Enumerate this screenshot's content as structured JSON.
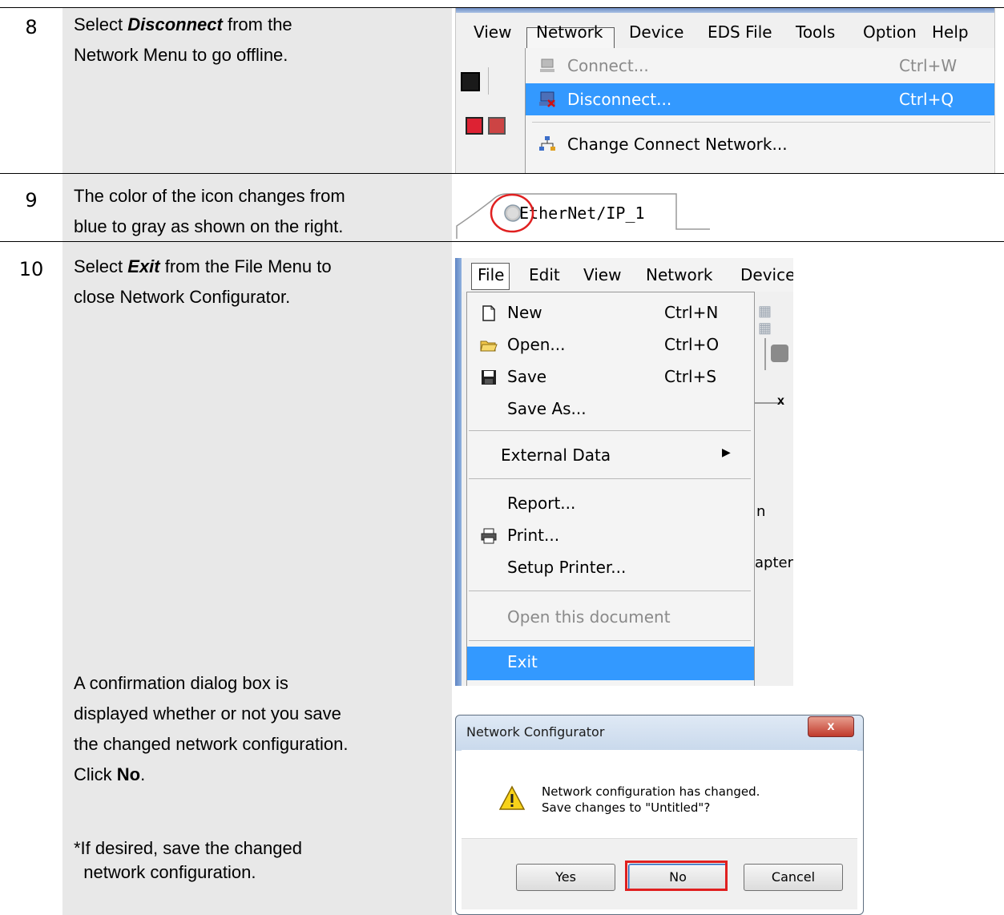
{
  "steps": [
    {
      "number": "8",
      "text_parts": [
        "Select ",
        "Disconnect",
        " from the",
        "Network Menu to go offline."
      ]
    },
    {
      "number": "9",
      "lines": [
        "The color of the icon changes from",
        "blue to gray as shown on the right."
      ]
    },
    {
      "number": "10",
      "text_parts": [
        "Select ",
        "Exit",
        " from the File Menu to",
        "close Network Configurator."
      ],
      "confirm_lines": [
        "A confirmation dialog box is",
        "displayed whether or not you save",
        "the changed network configuration."
      ],
      "click_prefix": "Click ",
      "click_target": "No",
      "click_suffix": ".",
      "note_lines": [
        "*If desired, save the changed",
        "network configuration."
      ]
    }
  ],
  "network_menu_shot": {
    "menubar": [
      "View",
      "Network",
      "Device",
      "EDS File",
      "Tools",
      "Option",
      "Help"
    ],
    "items": [
      {
        "label": "Connect...",
        "shortcut": "Ctrl+W",
        "state": "disabled"
      },
      {
        "label": "Disconnect...",
        "shortcut": "Ctrl+Q",
        "state": "highlighted"
      },
      {
        "label": "Change Connect Network...",
        "shortcut": "",
        "state": "normal"
      }
    ]
  },
  "tab_shot": {
    "tab_label": "EtherNet/IP_1"
  },
  "file_menu_shot": {
    "menubar": [
      "File",
      "Edit",
      "View",
      "Network",
      "Device"
    ],
    "items": [
      {
        "label": "New",
        "shortcut": "Ctrl+N"
      },
      {
        "label": "Open...",
        "shortcut": "Ctrl+O"
      },
      {
        "label": "Save",
        "shortcut": "Ctrl+S"
      },
      {
        "label": "Save As...",
        "shortcut": ""
      },
      {
        "label": "External Data",
        "shortcut": ""
      },
      {
        "label": "Report...",
        "shortcut": ""
      },
      {
        "label": "Print...",
        "shortcut": ""
      },
      {
        "label": "Setup Printer...",
        "shortcut": ""
      },
      {
        "label": "Open this document",
        "shortcut": "",
        "state": "disabled"
      },
      {
        "label": "Exit",
        "shortcut": "",
        "state": "highlighted"
      }
    ],
    "background_text": [
      "n",
      "apter"
    ]
  },
  "dialog": {
    "title": "Network Configurator",
    "close_glyph": "x",
    "message_line1": "Network configuration has changed.",
    "message_line2": "Save changes to \"Untitled\"?",
    "buttons": {
      "yes": "Yes",
      "no": "No",
      "cancel": "Cancel"
    }
  },
  "colors": {
    "highlight": "#3399ff",
    "annotation_red": "#e02020",
    "sidebar_gray": "#e8e8e8"
  }
}
